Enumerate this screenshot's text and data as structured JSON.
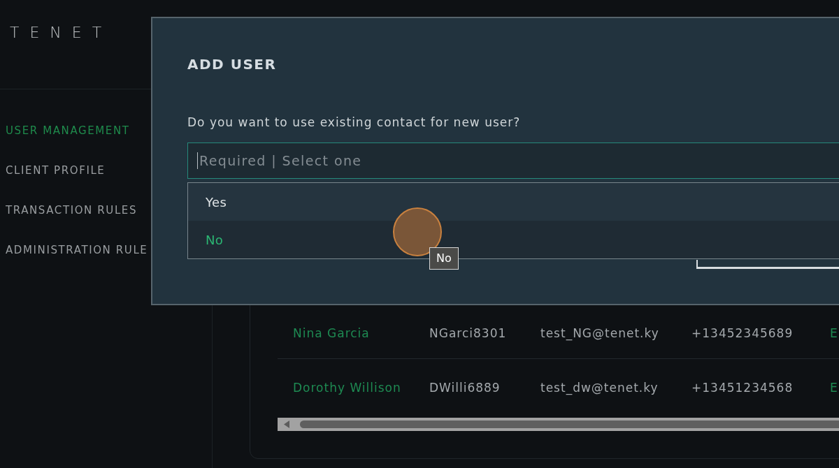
{
  "logo": {
    "text": "TENET"
  },
  "sidebar": {
    "items": [
      {
        "label": "USER MANAGEMENT",
        "selected": true
      },
      {
        "label": "CLIENT PROFILE",
        "selected": false
      },
      {
        "label": "TRANSACTION RULES",
        "selected": false
      },
      {
        "label": "ADMINISTRATION RULE",
        "selected": false
      }
    ]
  },
  "table": {
    "rows": [
      {
        "cells": [
          "Nina Garcia",
          "NGarci8301",
          "test_NG@tenet.ky",
          "+13452345689",
          "E"
        ]
      },
      {
        "cells": [
          "Dorothy Willison",
          "DWilli6889",
          "test_dw@tenet.ky",
          "+13451234568",
          "E"
        ]
      }
    ]
  },
  "dialog": {
    "title": "ADD USER",
    "question": "Do you want to use existing contact for new user?",
    "select": {
      "placeholder": "Required | Select one",
      "expanded": true,
      "options": [
        {
          "label": "Yes",
          "selected": false
        },
        {
          "label": "No",
          "selected": true
        }
      ]
    }
  },
  "tooltip": {
    "text": "No"
  }
}
